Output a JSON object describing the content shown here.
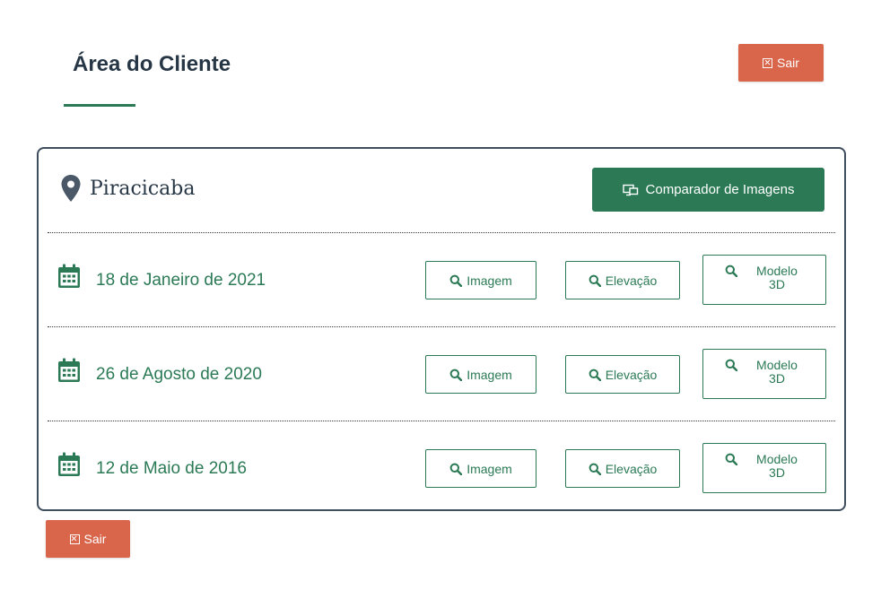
{
  "header": {
    "title": "Área do Cliente",
    "logout_label": "Sair"
  },
  "location": {
    "name": "Piracicaba",
    "compare_button": "Comparador de Imagens"
  },
  "rows": [
    {
      "date": "18 de Janeiro de 2021",
      "image_label": "Imagem",
      "elevation_label": "Elevação",
      "model_label": "Modelo 3D"
    },
    {
      "date": "26 de Agosto de 2020",
      "image_label": "Imagem",
      "elevation_label": "Elevação",
      "model_label": "Modelo 3D"
    },
    {
      "date": "12 de Maio de 2016",
      "image_label": "Imagem",
      "elevation_label": "Elevação",
      "model_label": "Modelo 3D"
    }
  ],
  "footer": {
    "logout_label": "Sair"
  },
  "colors": {
    "accent_green": "#2b7a55",
    "logout_red": "#d9654b",
    "heading_dark": "#263645",
    "card_border": "#3f4e5d"
  },
  "icons": {
    "logout": "close-box-icon",
    "location": "map-marker-icon",
    "compare": "compare-screens-icon",
    "date": "calendar-icon",
    "search": "magnifier-icon"
  }
}
